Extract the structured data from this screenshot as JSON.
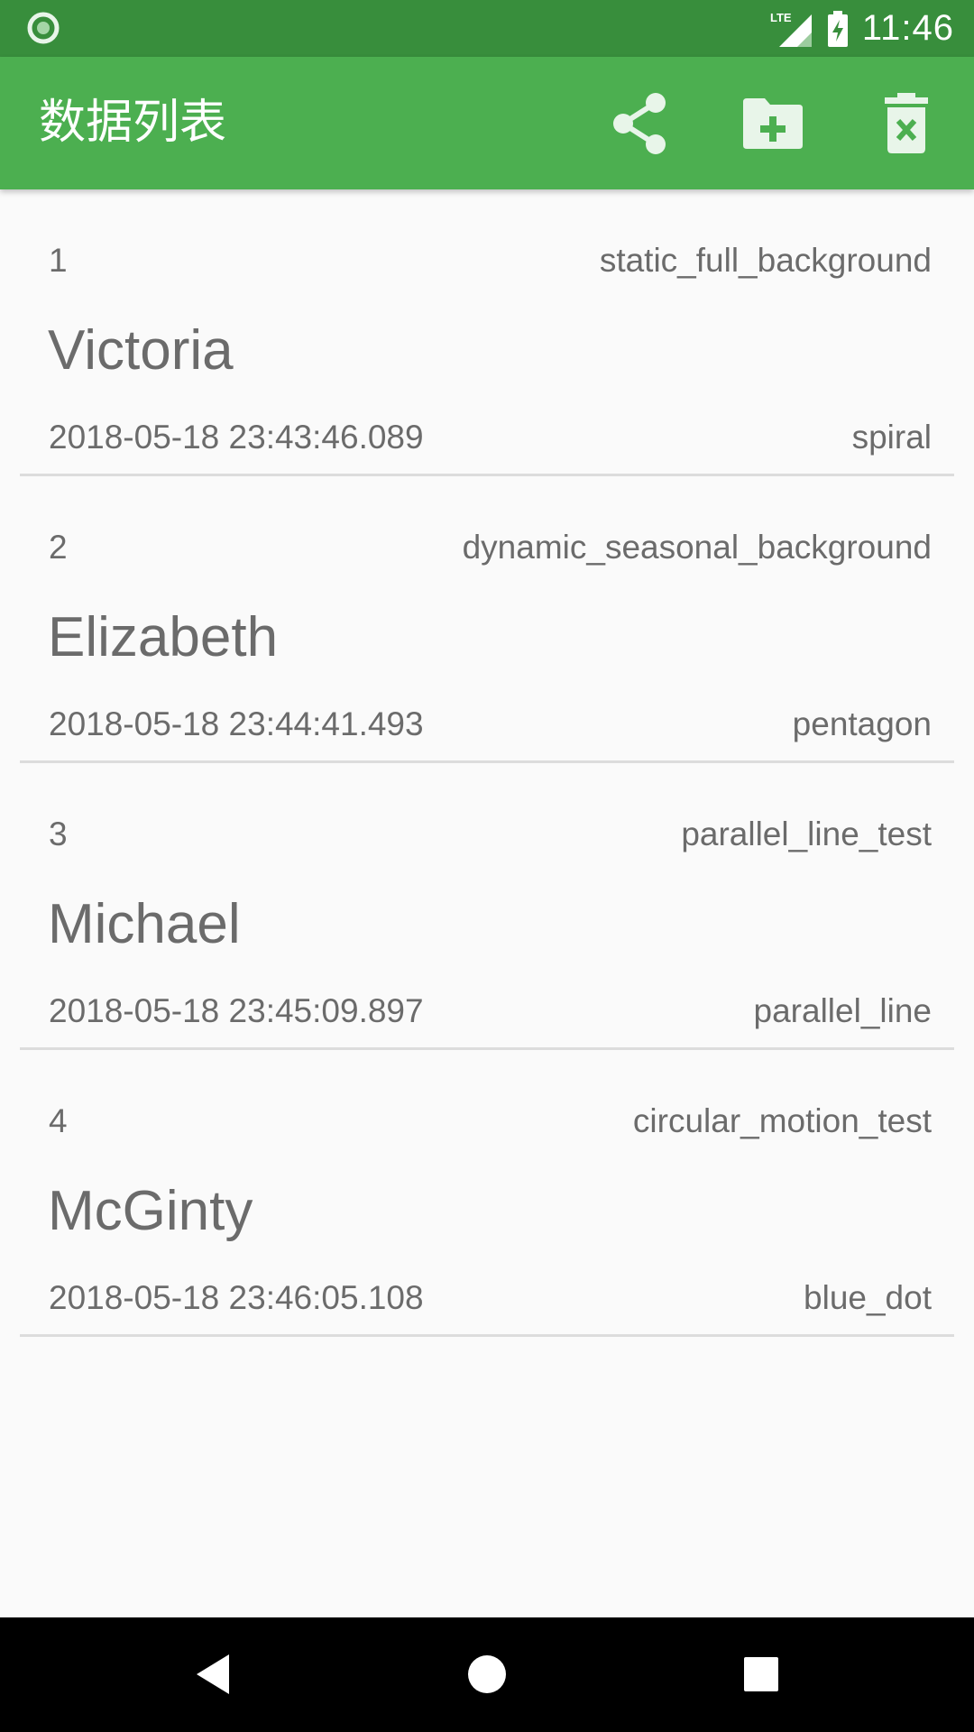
{
  "status_bar": {
    "time": "11:46",
    "network": "LTE",
    "icons": [
      "notification-ring-icon",
      "signal-icon",
      "battery-charging-icon"
    ]
  },
  "app_bar": {
    "title": "数据列表",
    "actions": [
      "share-icon",
      "folder-add-icon",
      "delete-icon"
    ]
  },
  "rows": [
    {
      "index": "1",
      "test": "static_full_background",
      "name": "Victoria",
      "time": "2018-05-18 23:43:46.089",
      "pattern": "spiral"
    },
    {
      "index": "2",
      "test": "dynamic_seasonal_background",
      "name": "Elizabeth",
      "time": "2018-05-18 23:44:41.493",
      "pattern": "pentagon"
    },
    {
      "index": "3",
      "test": "parallel_line_test",
      "name": "Michael",
      "time": "2018-05-18 23:45:09.897",
      "pattern": "parallel_line"
    },
    {
      "index": "4",
      "test": "circular_motion_test",
      "name": "McGinty",
      "time": "2018-05-18 23:46:05.108",
      "pattern": "blue_dot"
    }
  ],
  "nav_bar": {
    "buttons": [
      "back-icon",
      "home-icon",
      "recents-icon"
    ]
  },
  "colors": {
    "status_bar": "#388e3c",
    "app_bar": "#4caf50",
    "background": "#fafafa",
    "text": "#6b6b6b",
    "divider": "#dcdcdc"
  }
}
